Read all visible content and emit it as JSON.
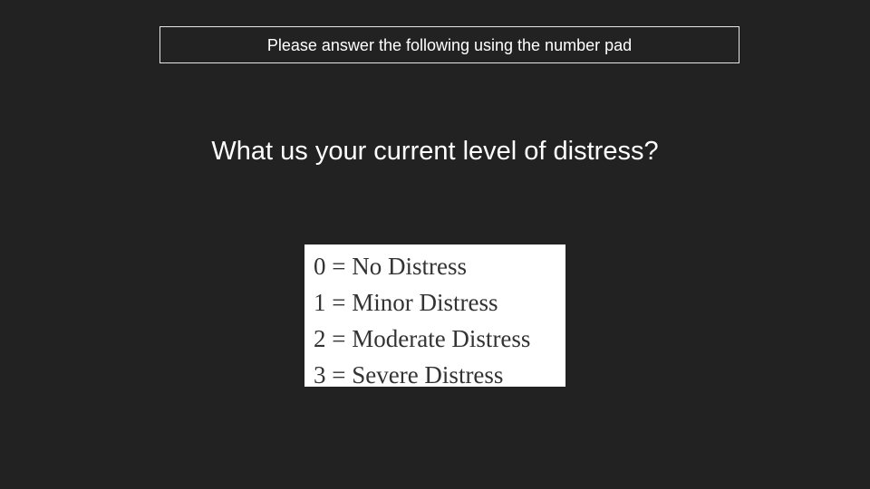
{
  "instruction": "Please answer the following using the number pad",
  "question": "What us your current level of distress?",
  "scale": [
    "0 = No Distress",
    "1 = Minor Distress",
    "2 = Moderate Distress",
    "3 = Severe Distress"
  ],
  "colors": {
    "background": "#222222",
    "text": "#ffffff",
    "panel": "#ffffff",
    "panel_text": "#333333"
  }
}
